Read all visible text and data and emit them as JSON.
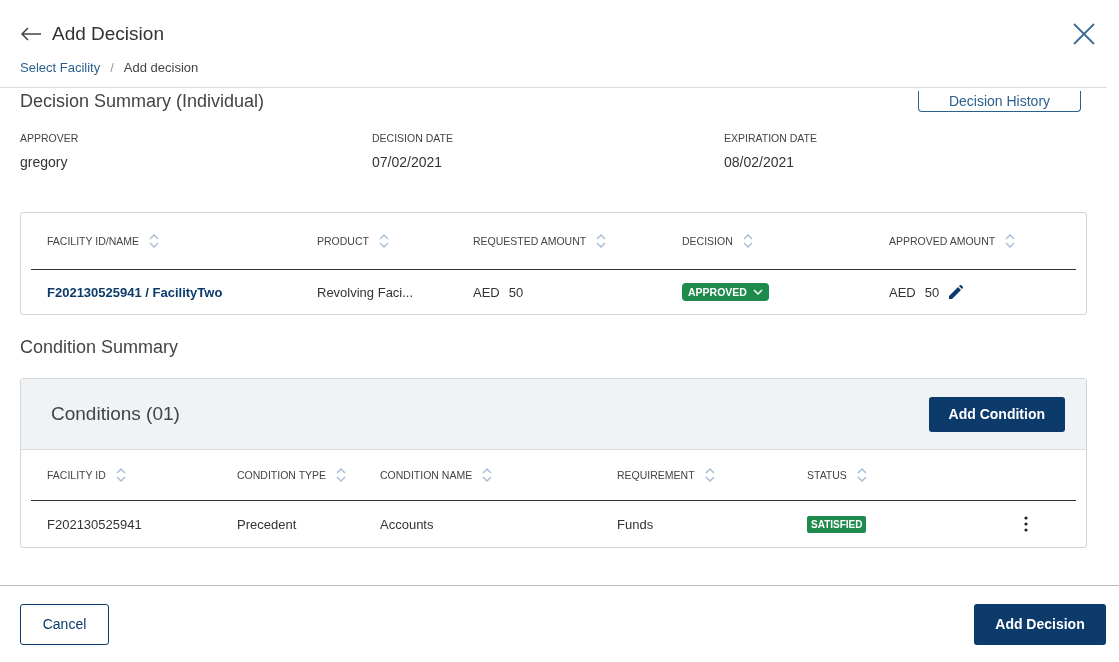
{
  "header": {
    "title": "Add Decision",
    "breadcrumb": [
      {
        "label": "Select Facility",
        "link": true
      },
      {
        "label": "Add decision",
        "link": false
      }
    ],
    "breadcrumb_separator": "/"
  },
  "decision_summary": {
    "title": "Decision Summary (Individual)",
    "history_button": "Decision History",
    "fields": [
      {
        "label": "APPROVER",
        "value": "gregory"
      },
      {
        "label": "DECISION DATE",
        "value": "07/02/2021"
      },
      {
        "label": "EXPIRATION DATE",
        "value": "08/02/2021"
      }
    ]
  },
  "facility_table": {
    "columns": [
      "FACILITY ID/NAME",
      "PRODUCT",
      "REQUESTED AMOUNT",
      "DECISION",
      "APPROVED AMOUNT"
    ],
    "rows": [
      {
        "facility": "F202130525941 / FacilityTwo",
        "product": "Revolving Faci...",
        "requested_currency": "AED",
        "requested_amount": "50",
        "decision": "APPROVED",
        "approved_currency": "AED",
        "approved_amount": "50"
      }
    ]
  },
  "condition_summary": {
    "title": "Condition Summary",
    "panel_title": "Conditions (01)",
    "add_button": "Add Condition",
    "columns": [
      "FACILITY ID",
      "CONDITION TYPE",
      "CONDITION NAME",
      "REQUIREMENT",
      "STATUS"
    ],
    "rows": [
      {
        "facility_id": "F202130525941",
        "condition_type": "Precedent",
        "condition_name": "Accounts",
        "requirement": "Funds",
        "status": "SATISFIED"
      }
    ]
  },
  "footer": {
    "cancel": "Cancel",
    "submit": "Add Decision"
  }
}
